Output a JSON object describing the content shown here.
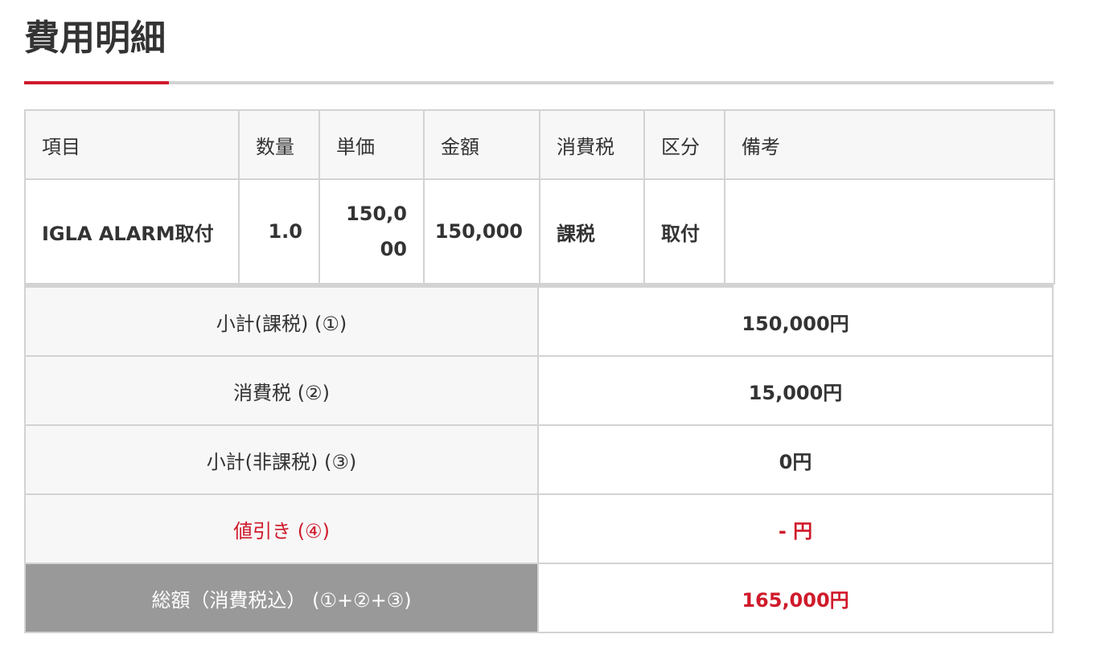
{
  "page": {
    "title": "費用明細"
  },
  "colors": {
    "accent": "#cf1b2b",
    "border": "#d3d3d3",
    "header_bg": "#f7f7f7",
    "grand_label_bg": "#999999"
  },
  "items_table": {
    "headers": [
      "項目",
      "数量",
      "単価",
      "金額",
      "消費税",
      "区分",
      "備考"
    ],
    "rows": [
      {
        "item": "IGLA ALARM取付",
        "quantity": "1.0",
        "unit_price": "150,000",
        "amount": "150,000",
        "tax": "課税",
        "category": "取付",
        "note": ""
      }
    ]
  },
  "totals": {
    "subtotal_taxable": {
      "label": "小計(課税) (①)",
      "value": "150,000円"
    },
    "consumption_tax": {
      "label": "消費税 (②)",
      "value": "15,000円"
    },
    "subtotal_nontaxable": {
      "label": "小計(非課税) (③)",
      "value": "0円"
    },
    "discount": {
      "label": "値引き (④)",
      "value": "- 円"
    },
    "grand_total": {
      "label": "総額（消費税込） (①+②+③)",
      "value": "165,000円"
    }
  }
}
